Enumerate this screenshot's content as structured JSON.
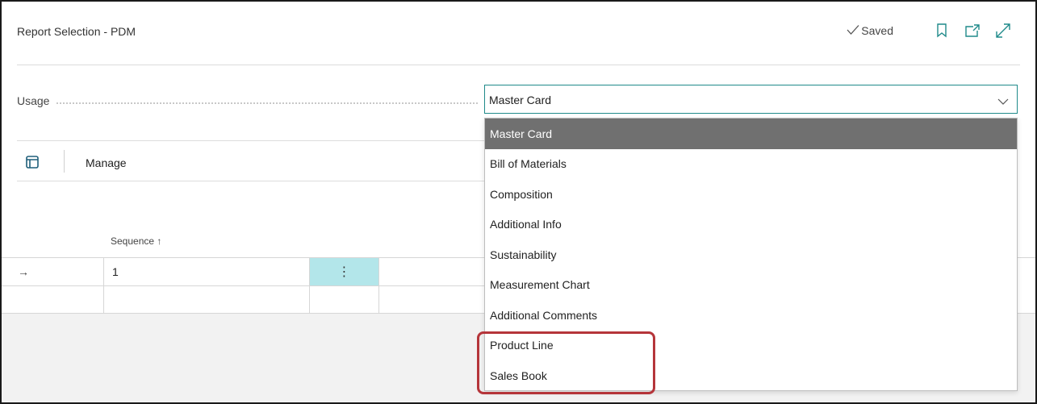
{
  "window": {
    "title": "Report Selection - PDM",
    "saved_label": "Saved",
    "icons": [
      "check-icon",
      "bookmark-icon",
      "open-in-new-window-icon",
      "expand-icon"
    ]
  },
  "usage": {
    "label": "Usage",
    "value": "Master Card",
    "options": [
      "Master Card",
      "Bill of Materials",
      "Composition",
      "Additional Info",
      "Sustainability",
      "Measurement Chart",
      "Additional Comments",
      "Product Line",
      "Sales Book"
    ],
    "selected_index": 0
  },
  "actionbar": {
    "manage_label": "Manage"
  },
  "table": {
    "columns": [
      "Sequence ↑"
    ],
    "rows": [
      {
        "indicator": "→",
        "sequence": "1",
        "menu": "⋮"
      }
    ]
  },
  "colors": {
    "accent": "#1f8a8a",
    "selected_option_bg": "#707070",
    "row_menu_bg": "#b3e6ea",
    "highlight_border": "#b5353a"
  }
}
